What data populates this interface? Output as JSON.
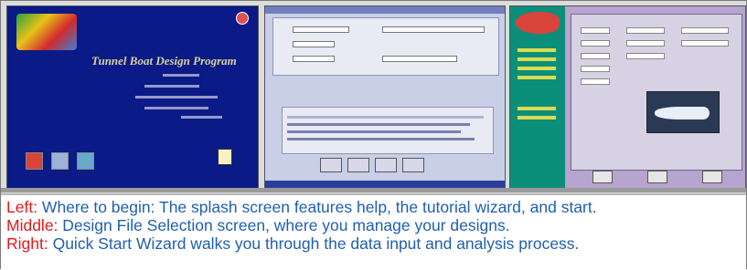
{
  "screenshots": {
    "left": {
      "logo": "",
      "title": "Tunnel Boat Design Program"
    }
  },
  "captions": [
    {
      "key": "Left:",
      "text": " Where to begin: The splash screen features help, the tutorial wizard, and start."
    },
    {
      "key": "Middle:",
      "text": " Design File Selection screen, where you manage your designs."
    },
    {
      "key": "Right:",
      "text": " Quick Start Wizard walks you through the data input and analysis process."
    }
  ],
  "colors": {
    "caption_key": "#e21a1a",
    "caption_text": "#1f5fb0",
    "splash_bg": "#0a1a86"
  }
}
